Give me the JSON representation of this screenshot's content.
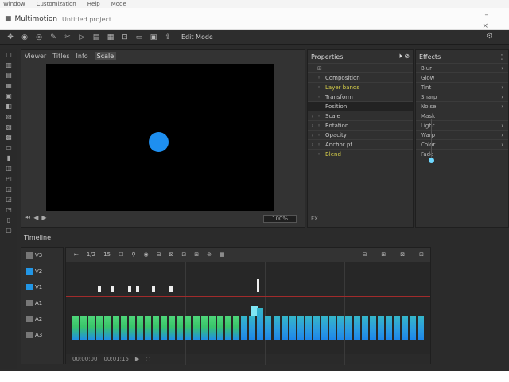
{
  "menu": {
    "items": [
      "Window",
      "Customization",
      "Help",
      "Mode"
    ]
  },
  "window": {
    "app_name": "Multimotion",
    "doc_name": "Untitled project",
    "min_symbol": "–",
    "close_symbol": "×"
  },
  "toolbar": {
    "icons": [
      "move-icon",
      "eye-icon",
      "camera-icon",
      "pen-icon",
      "scissors-icon",
      "play-icon",
      "layers-icon",
      "grid-icon",
      "crop-icon",
      "frame-icon",
      "folder-icon",
      "export-icon"
    ],
    "label": "Edit Mode",
    "right_icon": "⚙"
  },
  "rail": {
    "icons": [
      "select-icon",
      "move-icon",
      "trim-icon",
      "cut-icon",
      "ripple-icon",
      "layer-icon",
      "text-icon",
      "shape-icon",
      "mask-icon",
      "image-icon",
      "audio-icon",
      "marker-icon",
      "effect-icon",
      "color-icon",
      "transition-icon",
      "keyframe-icon",
      "camera-icon",
      "export-icon"
    ]
  },
  "viewer": {
    "tabs": [
      "Viewer",
      "Titles",
      "Info",
      "Scale"
    ],
    "controls": [
      "⏮",
      "◀",
      "▶"
    ],
    "zoom": "100%"
  },
  "properties": {
    "title": "Properties",
    "head_icons": "⏵ ⊘",
    "top_icon": "⊞",
    "rows": [
      {
        "caret": "",
        "icon": "◦",
        "label": "Composition",
        "hl": false,
        "selected": false
      },
      {
        "caret": "",
        "icon": "◦",
        "label": "Layer bands",
        "hl": true,
        "selected": false
      },
      {
        "caret": "",
        "icon": "◦",
        "label": "Transform",
        "hl": false,
        "selected": false
      },
      {
        "caret": "",
        "icon": "",
        "label": "Position",
        "hl": false,
        "selected": true
      },
      {
        "caret": "›",
        "icon": "◦",
        "label": "Scale",
        "hl": false,
        "selected": false
      },
      {
        "caret": "›",
        "icon": "◦",
        "label": "Rotation",
        "hl": false,
        "selected": false
      },
      {
        "caret": "›",
        "icon": "◦",
        "label": "Opacity",
        "hl": false,
        "selected": false
      },
      {
        "caret": "›",
        "icon": "◦",
        "label": "Anchor pt",
        "hl": false,
        "selected": false
      },
      {
        "caret": "",
        "icon": "◦",
        "label": "Blend",
        "hl": true,
        "selected": false
      }
    ],
    "footer": "FX"
  },
  "effects": {
    "title": "Effects",
    "head_icon": "⋮",
    "rows": [
      {
        "label": "Blur",
        "arrow": "›"
      },
      {
        "label": "Glow",
        "arrow": ""
      },
      {
        "label": "Tint",
        "arrow": "›"
      },
      {
        "label": "Sharp",
        "arrow": "›"
      },
      {
        "label": "Noise",
        "arrow": "›"
      },
      {
        "label": "Mask",
        "arrow": ""
      },
      {
        "label": "Light",
        "arrow": "›"
      },
      {
        "label": "Warp",
        "arrow": "›"
      },
      {
        "label": "Color",
        "arrow": "›"
      },
      {
        "label": "Fade",
        "arrow": ""
      }
    ]
  },
  "timeline": {
    "title": "Timeline",
    "tracks": [
      {
        "label": "V3"
      },
      {
        "label": "V2"
      },
      {
        "label": "V1"
      },
      {
        "label": "A1"
      },
      {
        "label": "A2"
      },
      {
        "label": "A3"
      }
    ],
    "tools": [
      "⇤",
      "1/2",
      "15",
      "☐",
      "⚲",
      "◉",
      "⊟",
      "⊠",
      "⊡",
      "⊞",
      "⊚",
      "▦"
    ],
    "tools_right": [
      "⊟",
      "⊞",
      "⊠",
      "⊡"
    ],
    "bottom": [
      "00:00:00",
      "00:01:15",
      "▶",
      "◌"
    ]
  }
}
